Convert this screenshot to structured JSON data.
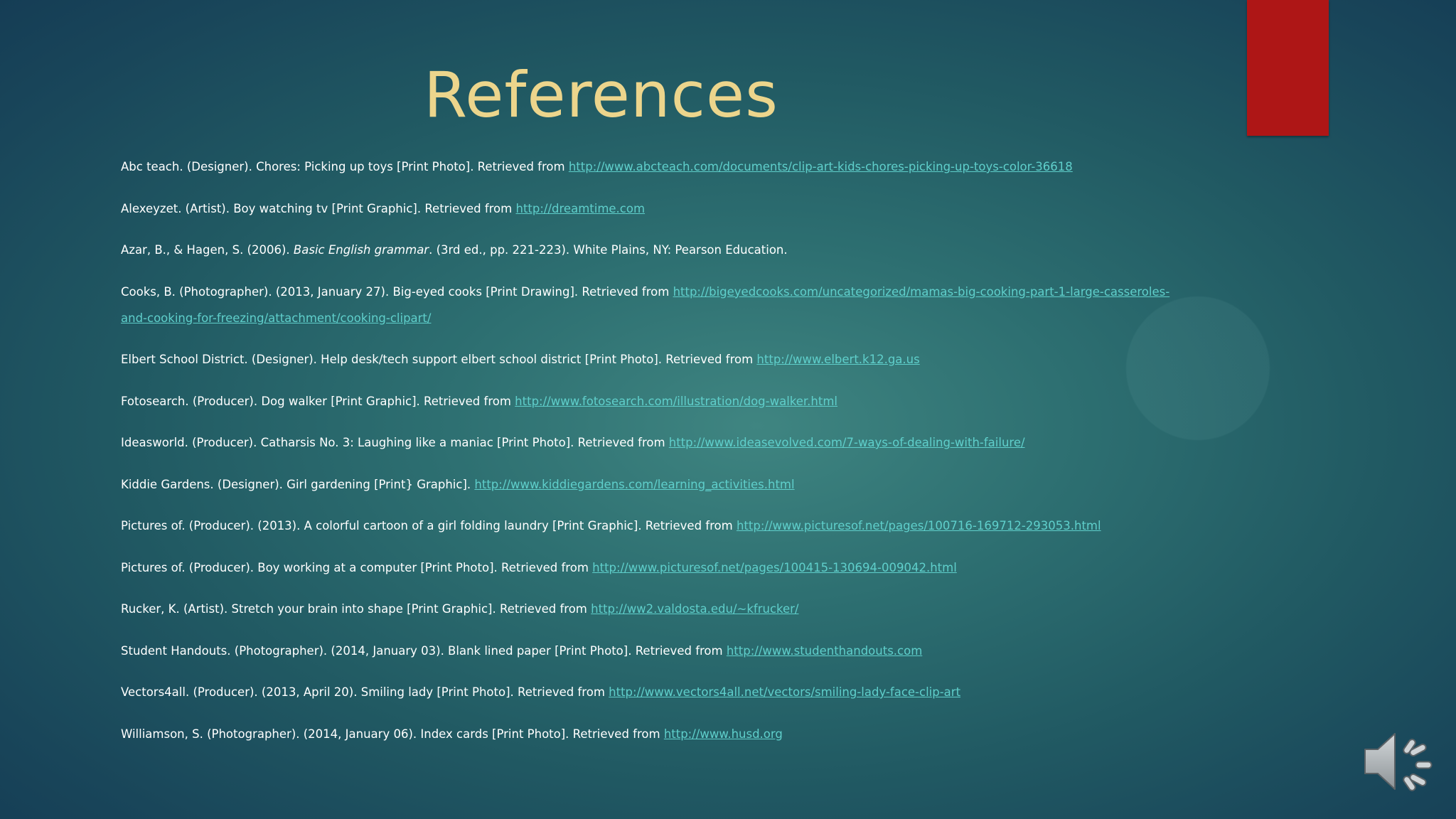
{
  "slide": {
    "title": "References",
    "accent_color": "#ae1616",
    "title_color": "#ecd58c",
    "link_color": "#5fcfcb"
  },
  "references": [
    {
      "text": "Abc teach. (Designer). Chores: Picking up toys [Print Photo]. Retrieved from ",
      "link": "http://www.abcteach.com/documents/clip-art-kids-chores-picking-up-toys-color-36618"
    },
    {
      "text": "Alexeyzet. (Artist). Boy watching tv [Print Graphic]. Retrieved from ",
      "link": "http://dreamtime.com"
    },
    {
      "text": "Azar, B., & Hagen, S. (2006). ",
      "italic": "Basic English grammar",
      "tail": ". (3rd ed., pp. 221-223). White Plains, NY: Pearson Education."
    },
    {
      "text": "Cooks, B. (Photographer). (2013, January 27). Big-eyed cooks [Print Drawing]. Retrieved from ",
      "link": "http://bigeyedcooks.com/uncategorized/mamas-big-cooking-part-1-large-casseroles-and-cooking-for-freezing/attachment/cooking-clipart/"
    },
    {
      "text": "Elbert School District. (Designer). Help desk/tech support elbert school district [Print Photo]. Retrieved from ",
      "link": "http://www.elbert.k12.ga.us"
    },
    {
      "text": "Fotosearch. (Producer). Dog walker [Print Graphic]. Retrieved from ",
      "link": "http://www.fotosearch.com/illustration/dog-walker.html"
    },
    {
      "text": "Ideasworld. (Producer). Catharsis No. 3: Laughing like a maniac [Print Photo]. Retrieved from ",
      "link": "http://www.ideasevolved.com/7-ways-of-dealing-with-failure/"
    },
    {
      "text": "Kiddie Gardens. (Designer). Girl gardening [Print} Graphic]. ",
      "link": "http://www.kiddiegardens.com/learning_activities.html"
    },
    {
      "text": "Pictures of. (Producer). (2013). A colorful cartoon of a girl folding laundry [Print Graphic]. Retrieved from ",
      "link": "http://www.picturesof.net/pages/100716-169712-293053.html"
    },
    {
      "text": "Pictures of. (Producer). Boy working at a computer [Print Photo]. Retrieved from ",
      "link": "http://www.picturesof.net/pages/100415-130694-009042.html"
    },
    {
      "text": "Rucker, K. (Artist). Stretch your brain into shape [Print Graphic]. Retrieved from ",
      "link": "http://ww2.valdosta.edu/~kfrucker/"
    },
    {
      "text": "Student Handouts. (Photographer). (2014, January 03). Blank lined paper [Print Photo]. Retrieved from ",
      "link": "http://www.studenthandouts.com"
    },
    {
      "text": "Vectors4all. (Producer). (2013, April 20). Smiling lady [Print Photo]. Retrieved from ",
      "link": "http://www.vectors4all.net/vectors/smiling-lady-face-clip-art"
    },
    {
      "text": "Williamson, S. (Photographer). (2014, January 06). Index cards [Print Photo]. Retrieved from ",
      "link": "http://www.husd.org"
    }
  ],
  "audio": {
    "icon": "speaker-icon"
  }
}
